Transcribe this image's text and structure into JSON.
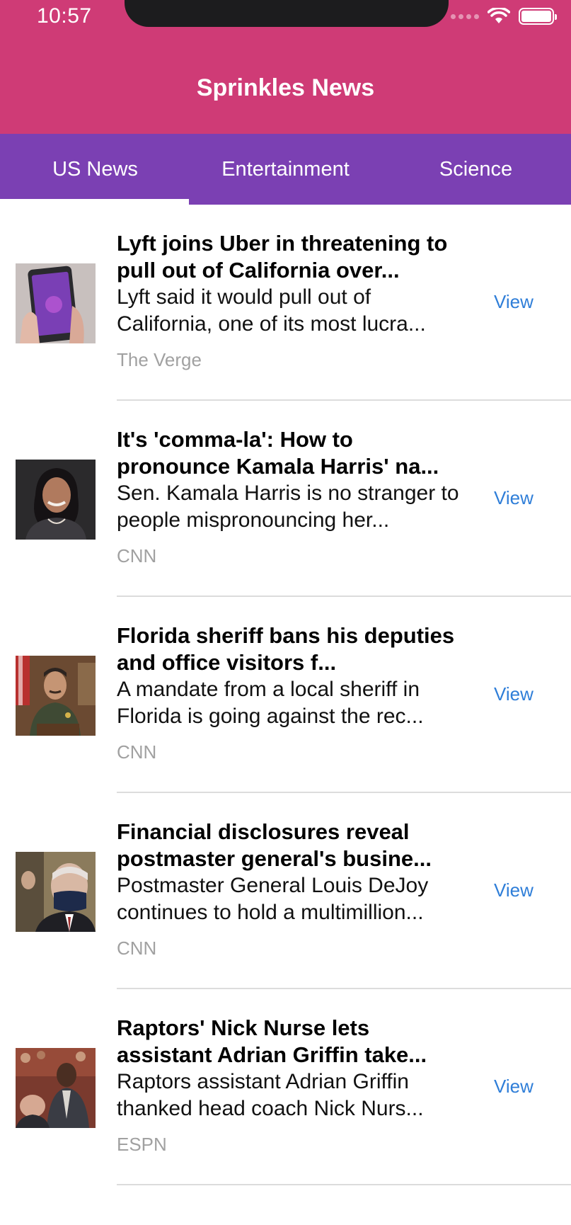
{
  "status_bar": {
    "time": "10:57"
  },
  "header": {
    "title": "Sprinkles News"
  },
  "tabs": [
    {
      "label": "US News",
      "active": true
    },
    {
      "label": "Entertainment",
      "active": false
    },
    {
      "label": "Science",
      "active": false
    }
  ],
  "articles": [
    {
      "headline": "Lyft joins Uber in threatening to pull out of California over...",
      "summary": "Lyft said it would pull out of California, one of its most lucra...",
      "source": "The Verge",
      "view_label": "View",
      "thumbnail_icon": "phone-in-hand-image"
    },
    {
      "headline": "It's 'comma-la': How to pronounce Kamala Harris' na...",
      "summary": "Sen. Kamala Harris is no stranger to people mispronouncing her...",
      "source": "CNN",
      "view_label": "View",
      "thumbnail_icon": "portrait-image"
    },
    {
      "headline": "Florida sheriff bans his deputies and office visitors f...",
      "summary": "A mandate from a local sheriff in Florida is going against the rec...",
      "source": "CNN",
      "view_label": "View",
      "thumbnail_icon": "sheriff-portrait-image"
    },
    {
      "headline": "Financial disclosures reveal postmaster general's busine...",
      "summary": "Postmaster General Louis DeJoy continues to hold a multimillion...",
      "source": "CNN",
      "view_label": "View",
      "thumbnail_icon": "masked-man-image"
    },
    {
      "headline": "Raptors' Nick Nurse lets assistant Adrian Griffin take...",
      "summary": "Raptors assistant Adrian Griffin thanked head coach Nick Nurs...",
      "source": "ESPN",
      "view_label": "View",
      "thumbnail_icon": "basketball-bench-image"
    }
  ],
  "colors": {
    "header_bg": "#cf3b76",
    "tabs_bg": "#7b40b3",
    "link": "#2f7ed8",
    "source_text": "#a1a1a1"
  }
}
